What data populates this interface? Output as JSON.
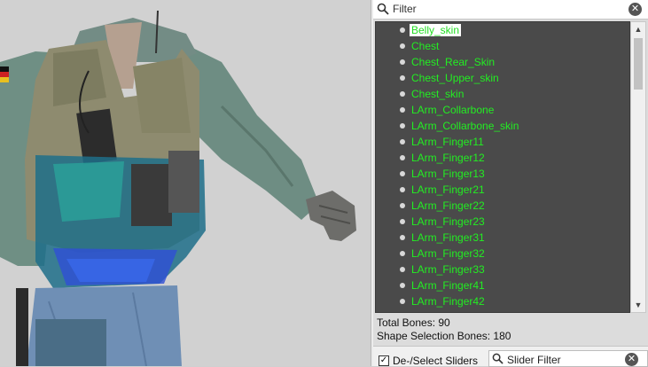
{
  "filter": {
    "placeholder": "Filter"
  },
  "bones": [
    "Belly_skin",
    "Chest",
    "Chest_Rear_Skin",
    "Chest_Upper_skin",
    "Chest_skin",
    "LArm_Collarbone",
    "LArm_Collarbone_skin",
    "LArm_Finger11",
    "LArm_Finger12",
    "LArm_Finger13",
    "LArm_Finger21",
    "LArm_Finger22",
    "LArm_Finger23",
    "LArm_Finger31",
    "LArm_Finger32",
    "LArm_Finger33",
    "LArm_Finger41",
    "LArm_Finger42"
  ],
  "selected_bone_index": 0,
  "info": {
    "total_bones": "Total Bones: 90",
    "shape_selection_bones": "Shape Selection Bones: 180"
  },
  "sliders": {
    "checkbox_label": "De-/Select Sliders",
    "filter_placeholder": "Slider Filter"
  },
  "colors": {
    "bone_text": "#22ee22",
    "list_bg": "#4a4a4a"
  }
}
